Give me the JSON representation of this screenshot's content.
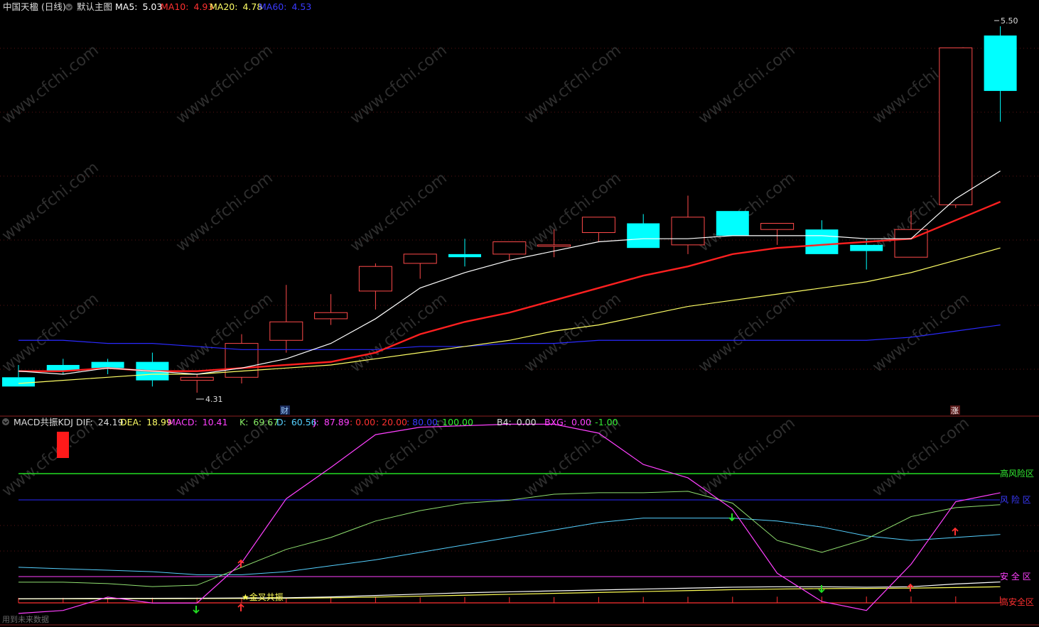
{
  "header": {
    "stock_name": "中国天楹",
    "period": "(日线)",
    "template_label": "默认主图",
    "ma5_label": "MA5:",
    "ma5_value": "5.03",
    "ma10_label": "MA10:",
    "ma10_value": "4.93",
    "ma20_label": "MA20:",
    "ma20_value": "4.78",
    "ma60_label": "MA60:",
    "ma60_value": "4.53"
  },
  "indicator_header": {
    "name": "MACD共振KDJ",
    "dif_label": "DIF:",
    "dif_value": "24.19",
    "dea_label": "DEA:",
    "dea_value": "18.99",
    "macd_label": "MACD:",
    "macd_value": "10.41",
    "k_label": "K:",
    "k_value": "69.67",
    "d_label": "D:",
    "d_value": "60.56",
    "j_label": "J:",
    "j_value": "87.89",
    "c0": ": 0.00",
    "c20": ": 20.00",
    "c80": ": 80.00",
    "c100": ": 100.00",
    "b4_label": "B4:",
    "b4_value": "0.00",
    "bxg_label": "BXG:",
    "bxg_value": "0.00",
    "neg_value": ": -1.00"
  },
  "labels": {
    "high_price": "5.50",
    "low_price": "4.31",
    "finance_marker": "财",
    "limit_up_marker": "涨",
    "zone_high_risk": "高风险区",
    "zone_risk": "风 险 区",
    "zone_safe": "安 全 区",
    "zone_high_safe": "高安全区",
    "golden_cross": "★金叉共振",
    "footer_note": "用到未来数据",
    "watermark": "www.cfchi.com"
  },
  "colors": {
    "up": "#ff4a4a",
    "down": "#00ffff",
    "ma5": "#ffffff",
    "ma10": "#ff2020",
    "ma20": "#ffff66",
    "ma60": "#2a2aff",
    "k": "#55d0ff",
    "d": "#90e070",
    "j": "#ff40ff"
  },
  "chart_data": [
    {
      "type": "candlestick",
      "ylim": [
        4.28,
        5.53
      ],
      "candles": [
        {
          "o": 4.36,
          "h": 4.4,
          "l": 4.33,
          "c": 4.33
        },
        {
          "o": 4.4,
          "h": 4.42,
          "l": 4.37,
          "c": 4.38
        },
        {
          "o": 4.41,
          "h": 4.42,
          "l": 4.37,
          "c": 4.39
        },
        {
          "o": 4.41,
          "h": 4.44,
          "l": 4.33,
          "c": 4.35
        },
        {
          "o": 4.35,
          "h": 4.37,
          "l": 4.31,
          "c": 4.36
        },
        {
          "o": 4.36,
          "h": 4.5,
          "l": 4.34,
          "c": 4.47
        },
        {
          "o": 4.48,
          "h": 4.66,
          "l": 4.44,
          "c": 4.54
        },
        {
          "o": 4.55,
          "h": 4.63,
          "l": 4.53,
          "c": 4.57
        },
        {
          "o": 4.64,
          "h": 4.73,
          "l": 4.58,
          "c": 4.72
        },
        {
          "o": 4.73,
          "h": 4.76,
          "l": 4.68,
          "c": 4.76
        },
        {
          "o": 4.76,
          "h": 4.81,
          "l": 4.72,
          "c": 4.75
        },
        {
          "o": 4.76,
          "h": 4.8,
          "l": 4.74,
          "c": 4.8
        },
        {
          "o": 4.79,
          "h": 4.84,
          "l": 4.75,
          "c": 4.79
        },
        {
          "o": 4.83,
          "h": 4.87,
          "l": 4.8,
          "c": 4.88
        },
        {
          "o": 4.86,
          "h": 4.89,
          "l": 4.78,
          "c": 4.78
        },
        {
          "o": 4.79,
          "h": 4.95,
          "l": 4.76,
          "c": 4.88
        },
        {
          "o": 4.9,
          "h": 4.9,
          "l": 4.82,
          "c": 4.82
        },
        {
          "o": 4.84,
          "h": 4.86,
          "l": 4.79,
          "c": 4.86
        },
        {
          "o": 4.84,
          "h": 4.87,
          "l": 4.76,
          "c": 4.76
        },
        {
          "o": 4.79,
          "h": 4.81,
          "l": 4.71,
          "c": 4.77
        },
        {
          "o": 4.75,
          "h": 4.9,
          "l": 4.75,
          "c": 4.84
        },
        {
          "o": 4.92,
          "h": 5.43,
          "l": 4.91,
          "c": 5.43
        },
        {
          "o": 5.47,
          "h": 5.5,
          "l": 5.19,
          "c": 5.29
        }
      ],
      "ma5": [
        4.38,
        4.37,
        4.39,
        4.38,
        4.37,
        4.39,
        4.42,
        4.47,
        4.55,
        4.65,
        4.7,
        4.74,
        4.77,
        4.8,
        4.81,
        4.81,
        4.82,
        4.82,
        4.82,
        4.81,
        4.81,
        4.94,
        5.03
      ],
      "ma10": [
        4.38,
        4.38,
        4.39,
        4.38,
        4.38,
        4.39,
        4.4,
        4.41,
        4.44,
        4.5,
        4.54,
        4.57,
        4.61,
        4.65,
        4.69,
        4.72,
        4.76,
        4.78,
        4.79,
        4.8,
        4.81,
        4.87,
        4.93
      ],
      "ma20": [
        4.34,
        4.35,
        4.36,
        4.37,
        4.37,
        4.38,
        4.39,
        4.4,
        4.42,
        4.44,
        4.46,
        4.48,
        4.51,
        4.53,
        4.56,
        4.59,
        4.61,
        4.63,
        4.65,
        4.67,
        4.7,
        4.74,
        4.78
      ],
      "ma60": [
        4.48,
        4.48,
        4.47,
        4.47,
        4.46,
        4.45,
        4.45,
        4.45,
        4.45,
        4.46,
        4.46,
        4.47,
        4.47,
        4.48,
        4.48,
        4.48,
        4.48,
        4.48,
        4.48,
        4.48,
        4.49,
        4.51,
        4.53
      ]
    },
    {
      "type": "line",
      "ylim": [
        -2,
        120
      ],
      "levels": [
        0,
        20,
        80,
        100
      ],
      "k": [
        30,
        29,
        28,
        27,
        25,
        25,
        27,
        31,
        35,
        40,
        45,
        50,
        55,
        60,
        63,
        63,
        63,
        61,
        57,
        51,
        48,
        50,
        52
      ],
      "d": [
        20,
        20,
        19,
        17,
        18,
        30,
        42,
        50,
        61,
        68,
        73,
        75,
        79,
        80,
        80,
        81,
        73,
        48,
        40,
        49,
        64,
        70,
        72
      ],
      "j": [
        -1,
        1,
        10,
        6,
        6,
        33,
        76,
        97,
        119,
        124,
        125,
        126,
        126,
        120,
        99,
        90,
        69,
        26,
        7,
        1,
        32,
        74,
        80
      ],
      "dif": [
        6.0,
        6.2,
        6.4,
        6.5,
        6.6,
        6.8,
        7.0,
        8.0,
        9.5,
        11.0,
        12.5,
        13.5,
        14.5,
        15.5,
        16.5,
        17.5,
        18.5,
        19.0,
        19.0,
        18.5,
        19.0,
        22.0,
        24.19
      ],
      "dea": [
        5.8,
        5.9,
        6.0,
        6.1,
        6.2,
        6.3,
        6.5,
        7.0,
        7.8,
        8.8,
        9.8,
        10.8,
        11.8,
        12.8,
        13.8,
        14.8,
        15.8,
        16.5,
        17.0,
        17.2,
        17.5,
        18.2,
        18.99
      ]
    }
  ]
}
